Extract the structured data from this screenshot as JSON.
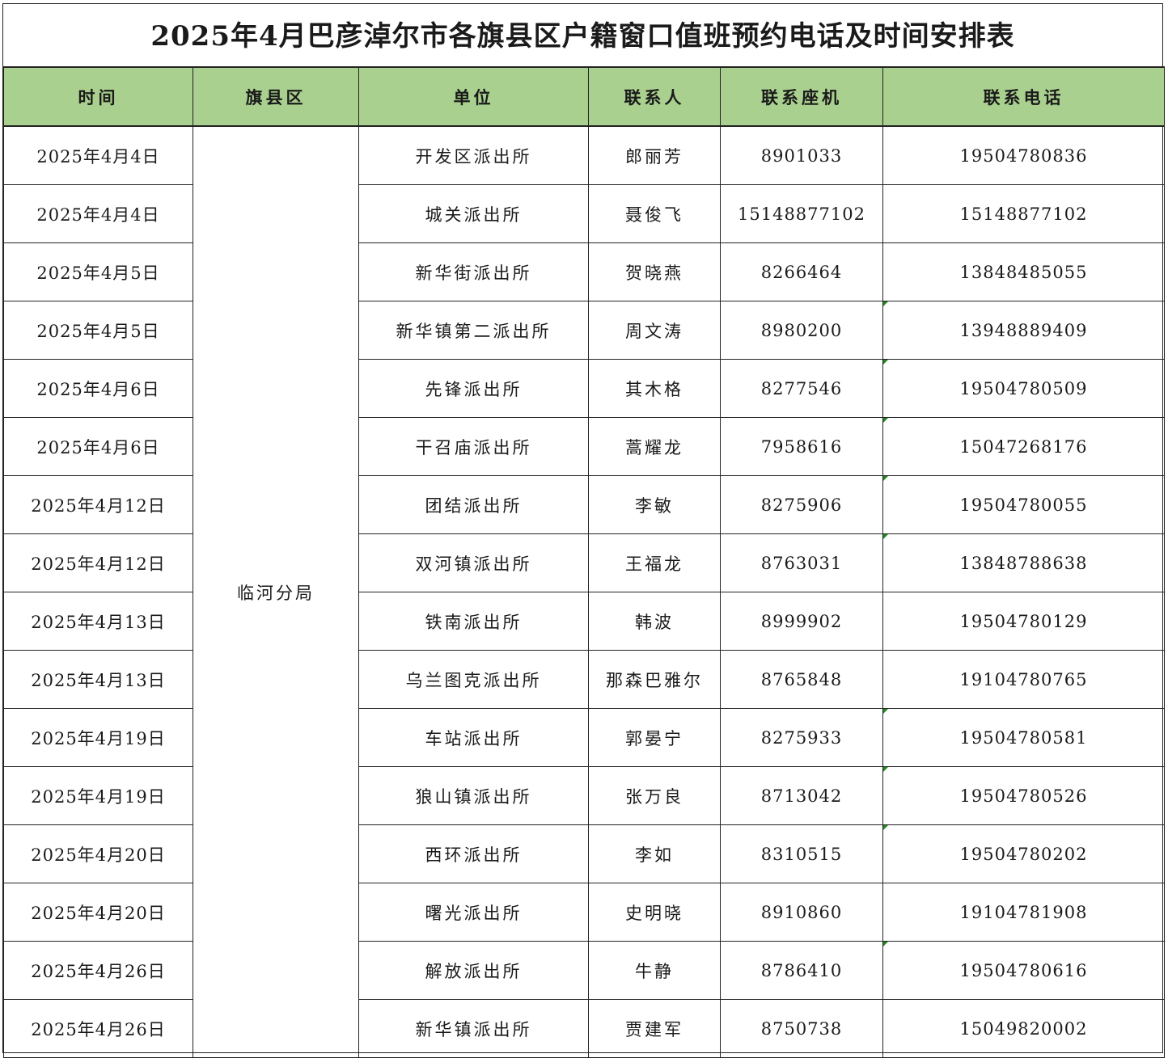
{
  "title": "2025年4月巴彦淖尔市各旗县区户籍窗口值班预约电话及时间安排表",
  "headers": {
    "time": "时间",
    "district": "旗县区",
    "unit": "单位",
    "contact": "联系人",
    "landline": "联系座机",
    "phone": "联系电话"
  },
  "district": "临河分局",
  "indicator_color": "#1f8a1f",
  "header_bg": "#a9d08e",
  "rows": [
    {
      "date": "2025年4月4日",
      "unit": "开发区派出所",
      "contact": "郎丽芳",
      "landline": "8901033",
      "phone": "19504780836",
      "marker": false
    },
    {
      "date": "2025年4月4日",
      "unit": "城关派出所",
      "contact": "聂俊飞",
      "landline": "15148877102",
      "phone": "15148877102",
      "marker": false
    },
    {
      "date": "2025年4月5日",
      "unit": "新华街派出所",
      "contact": "贺晓燕",
      "landline": "8266464",
      "phone": "13848485055",
      "marker": false
    },
    {
      "date": "2025年4月5日",
      "unit": "新华镇第二派出所",
      "contact": "周文涛",
      "landline": "8980200",
      "phone": "13948889409",
      "marker": true
    },
    {
      "date": "2025年4月6日",
      "unit": "先锋派出所",
      "contact": "其木格",
      "landline": "8277546",
      "phone": "19504780509",
      "marker": true
    },
    {
      "date": "2025年4月6日",
      "unit": "干召庙派出所",
      "contact": "蒿耀龙",
      "landline": "7958616",
      "phone": "15047268176",
      "marker": true
    },
    {
      "date": "2025年4月12日",
      "unit": "团结派出所",
      "contact": "李敏",
      "landline": "8275906",
      "phone": "19504780055",
      "marker": true
    },
    {
      "date": "2025年4月12日",
      "unit": "双河镇派出所",
      "contact": "王福龙",
      "landline": "8763031",
      "phone": "13848788638",
      "marker": true
    },
    {
      "date": "2025年4月13日",
      "unit": "铁南派出所",
      "contact": "韩波",
      "landline": "8999902",
      "phone": "19504780129",
      "marker": false
    },
    {
      "date": "2025年4月13日",
      "unit": "乌兰图克派出所",
      "contact": "那森巴雅尔",
      "landline": "8765848",
      "phone": "19104780765",
      "marker": false
    },
    {
      "date": "2025年4月19日",
      "unit": "车站派出所",
      "contact": "郭晏宁",
      "landline": "8275933",
      "phone": "19504780581",
      "marker": true
    },
    {
      "date": "2025年4月19日",
      "unit": "狼山镇派出所",
      "contact": "张万良",
      "landline": "8713042",
      "phone": "19504780526",
      "marker": true
    },
    {
      "date": "2025年4月20日",
      "unit": "西环派出所",
      "contact": "李如",
      "landline": "8310515",
      "phone": "19504780202",
      "marker": true
    },
    {
      "date": "2025年4月20日",
      "unit": "曙光派出所",
      "contact": "史明晓",
      "landline": "8910860",
      "phone": "19104781908",
      "marker": false
    },
    {
      "date": "2025年4月26日",
      "unit": "解放派出所",
      "contact": "牛静",
      "landline": "8786410",
      "phone": "19504780616",
      "marker": true
    },
    {
      "date": "2025年4月26日",
      "unit": "新华镇派出所",
      "contact": "贾建军",
      "landline": "8750738",
      "phone": "15049820002",
      "marker": false
    }
  ]
}
